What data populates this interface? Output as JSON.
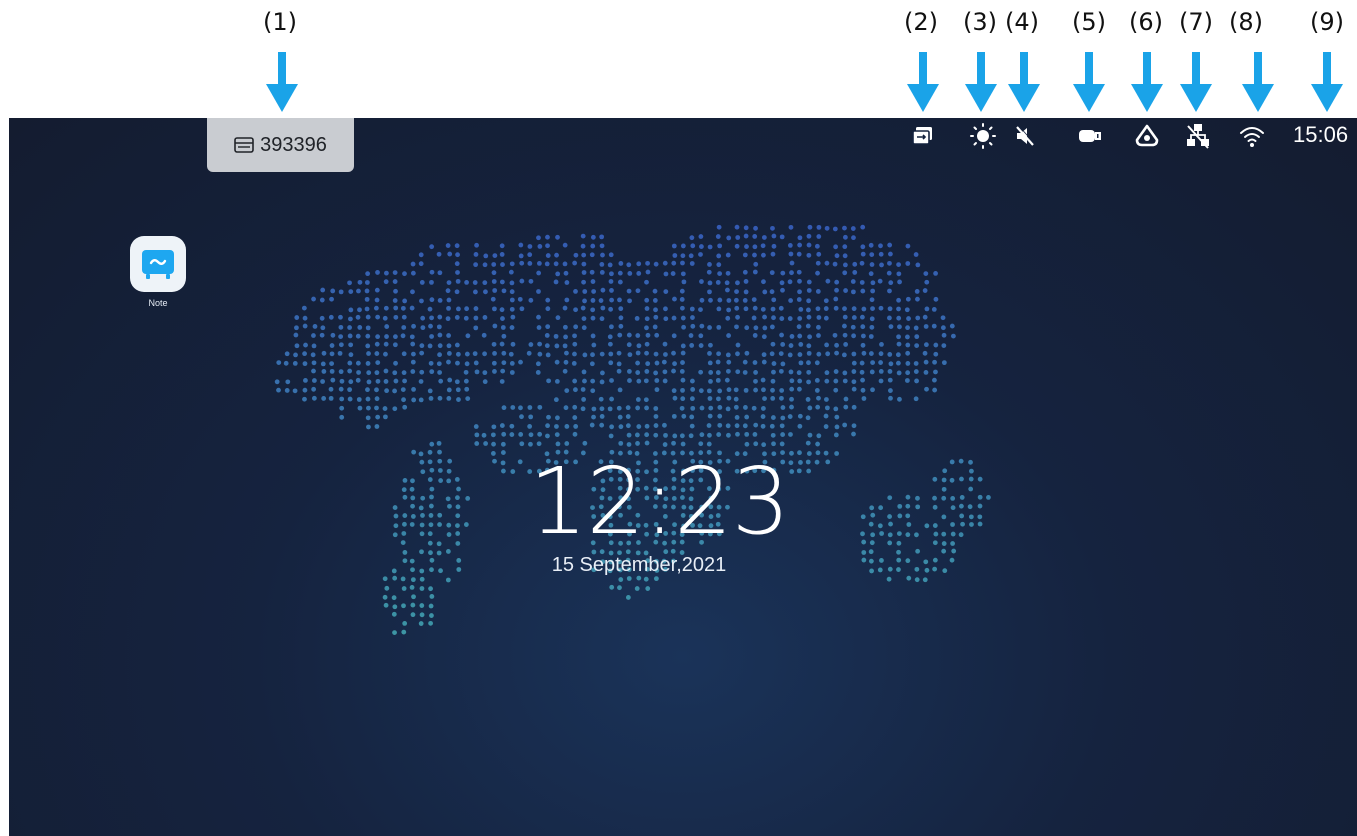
{
  "callouts": [
    "(1)",
    "(2)",
    "(3)",
    "(4)",
    "(5)",
    "(6)",
    "(7)",
    "(8)",
    "(9)"
  ],
  "room_badge": {
    "icon": "screen-share-icon",
    "code": "393396"
  },
  "status_bar": {
    "icons": [
      "cast-icon",
      "brightness-icon",
      "volume-mute-icon",
      "usb-drive-icon",
      "cloud-app-icon",
      "ethernet-disconnected-icon",
      "wifi-icon"
    ],
    "time": "15:06"
  },
  "desktop_apps": [
    {
      "label": "Note",
      "icon": "note-app-icon"
    }
  ],
  "home_clock": {
    "time": "12:23",
    "date": "15 September,2021"
  },
  "colors": {
    "accent_arrow": "#1aa3e8",
    "background": "#141c30",
    "map_dots": "#3b6fd1"
  }
}
